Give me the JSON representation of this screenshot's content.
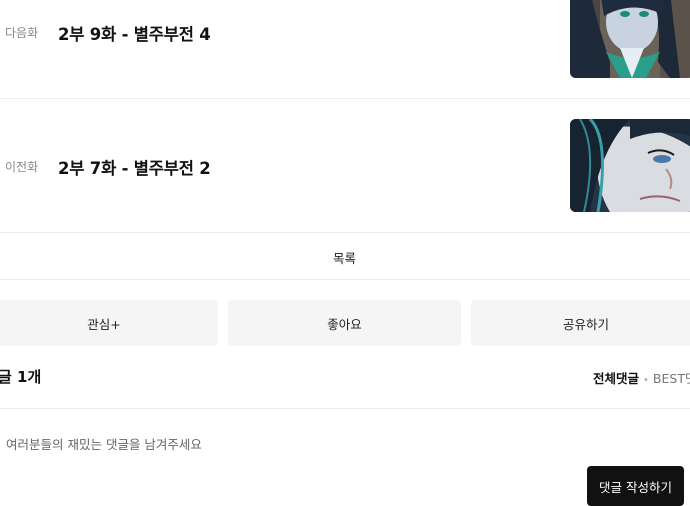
{
  "episodes": [
    {
      "tag": "다음화",
      "title": "2부 9화 - 별주부전 4"
    },
    {
      "tag": "이전화",
      "title": "2부 7화 - 별주부전 2"
    }
  ],
  "list_label": "목록",
  "actions": {
    "interest": "관심+",
    "like": "좋아요",
    "share": "공유하기"
  },
  "comments": {
    "count_label": "글 1개",
    "sort_all": "전체댓글",
    "sort_sep": "•",
    "sort_best": "BEST댓",
    "placeholder": "여러분들의 재밌는 댓글을 남겨주세요",
    "write_button": "댓글 작성하기"
  }
}
